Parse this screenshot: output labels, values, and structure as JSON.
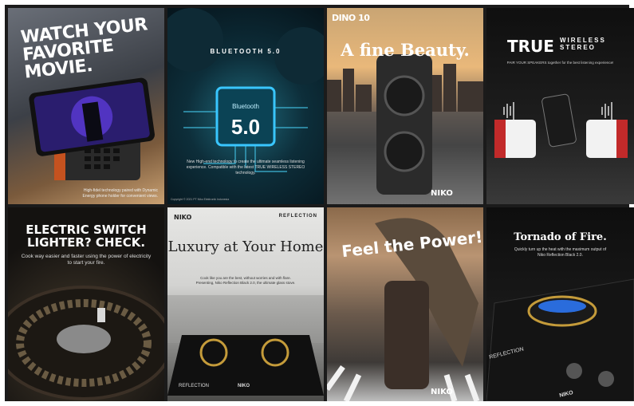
{
  "tiles": [
    {
      "id": "tile-1",
      "headline": "WATCH YOUR FAVORITE MOVIE.",
      "footer": "High-fidel technology paired with Dynamic Energy phone holder for convenient views."
    },
    {
      "id": "tile-2",
      "headline": "BLUETOOTH 5.0",
      "chip_label_top": "Bluetooth",
      "chip_label_main": "5.0",
      "description": "New High-end technology to create the ultimate seamless listening experience. Compatible with the latest TRUE WIRELESS STEREO technology.",
      "copyright": "Copyright © 2021 PT Niko Elektronik Indonesia"
    },
    {
      "id": "tile-3",
      "logo": "DINO 10",
      "headline": "A fine Beauty.",
      "brand": "NIKO"
    },
    {
      "id": "tile-4",
      "headline_true": "TRUE",
      "headline_rest_1": "WIRELESS",
      "headline_rest_2": "STEREO",
      "subline": "PAIR YOUR SPEAKERS together for the best listening experience!"
    },
    {
      "id": "tile-5",
      "headline": "ELECTRIC SWITCH LIGHTER? CHECK.",
      "subline": "Cook way easier and faster using the power of electricity to start your fire."
    },
    {
      "id": "tile-6",
      "logo": "NIKO",
      "product_tag": "REFLECTION",
      "headline": "Luxury at Your Home",
      "description": "Cook like you are the best, without worries and with flare. Presenting, Niko Reflection Black 2.0, the ultimate glass stove.",
      "stove_label": "REFLECTION",
      "stove_brand": "NIKO"
    },
    {
      "id": "tile-7",
      "headline": "Feel the Power!",
      "brand": "NIKO"
    },
    {
      "id": "tile-8",
      "headline": "Tornado of Fire.",
      "subline": "Quickly turn up the heat with the maximum output of Niko Reflection Black 2.0.",
      "stove_label": "REFLECTION",
      "stove_brand": "NIKO"
    }
  ],
  "colors": {
    "frame": "#1b1b1b",
    "page": "#ffffff",
    "flame_blue": "#2e7bff",
    "accent_red": "#c22a2a",
    "chip_glow": "#39c6ff"
  }
}
